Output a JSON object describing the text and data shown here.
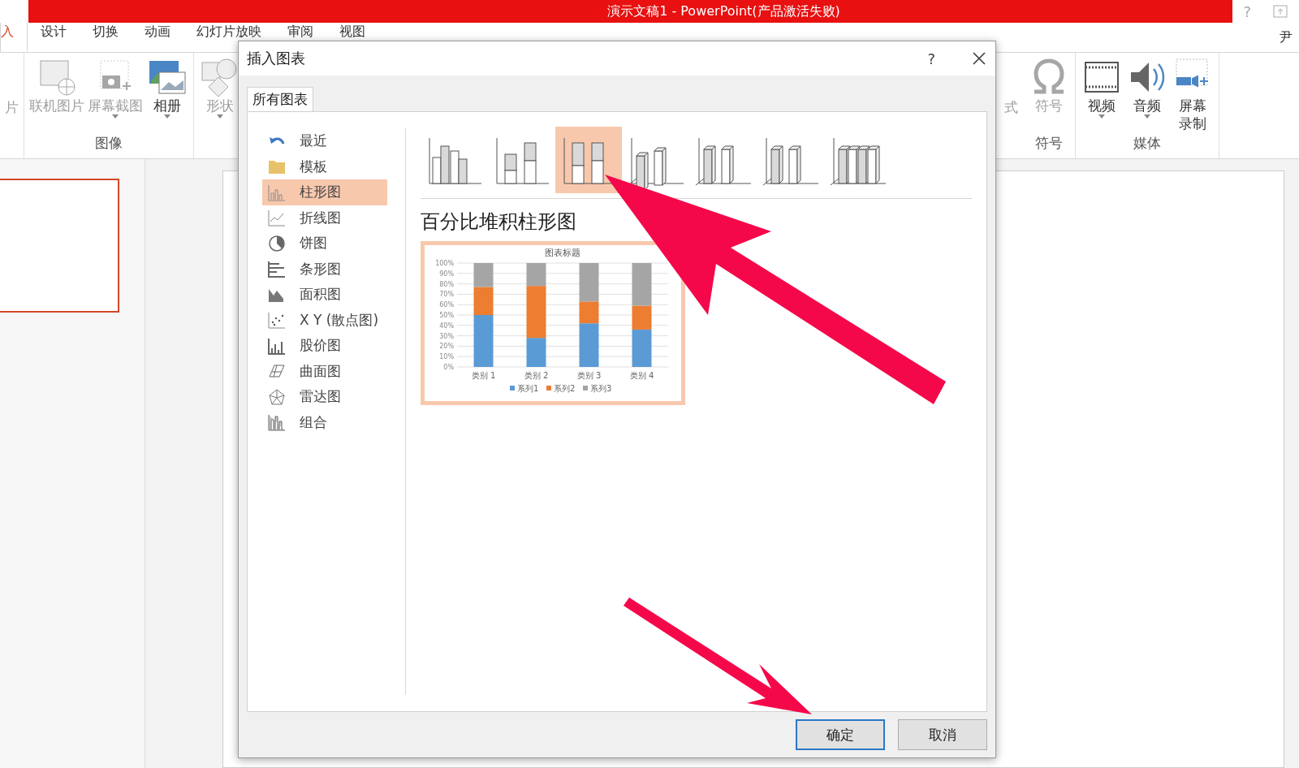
{
  "window": {
    "title": "演示文稿1 -  PowerPoint(产品激活失败)",
    "help": "?",
    "user": "尹"
  },
  "ribbon_tabs": [
    {
      "label": "入",
      "selected": true
    },
    {
      "label": "设计",
      "selected": false
    },
    {
      "label": "切换",
      "selected": false
    },
    {
      "label": "动画",
      "selected": false
    },
    {
      "label": "幻灯片放映",
      "selected": false
    },
    {
      "label": "审阅",
      "selected": false
    },
    {
      "label": "视图",
      "selected": false
    }
  ],
  "ribbon_left": {
    "cut_label": "片",
    "groups": [
      {
        "label": "图像",
        "items": [
          {
            "label": "联机图片",
            "kind": "online",
            "disabled": true,
            "dropdown": false
          },
          {
            "label": "屏幕截图",
            "kind": "screenshot",
            "disabled": true,
            "dropdown": true
          },
          {
            "label": "相册",
            "kind": "album",
            "disabled": false,
            "dropdown": true
          }
        ]
      },
      {
        "items": [
          {
            "label": "形状",
            "kind": "shapes",
            "disabled": true,
            "dropdown": true
          }
        ]
      }
    ]
  },
  "ribbon_right": {
    "cut_label": "式",
    "groups": [
      {
        "label": "符号",
        "items": [
          {
            "label": "符号",
            "kind": "omega",
            "disabled": true,
            "dropdown": false
          }
        ]
      },
      {
        "label": "媒体",
        "items": [
          {
            "label": "视频",
            "kind": "video",
            "disabled": false,
            "dropdown": true
          },
          {
            "label": "音频",
            "kind": "audio",
            "disabled": false,
            "dropdown": true
          },
          {
            "label": "屏幕录制",
            "kind": "record",
            "disabled": false,
            "dropdown": false
          }
        ]
      }
    ]
  },
  "dialog": {
    "title": "插入图表",
    "help": "?",
    "tab": "所有图表",
    "chart_types": [
      {
        "label": "最近",
        "kind": "recent",
        "selected": false
      },
      {
        "label": "模板",
        "kind": "folder",
        "selected": false
      },
      {
        "label": "柱形图",
        "kind": "column",
        "selected": true
      },
      {
        "label": "折线图",
        "kind": "line",
        "selected": false
      },
      {
        "label": "饼图",
        "kind": "pie",
        "selected": false
      },
      {
        "label": "条形图",
        "kind": "bar",
        "selected": false
      },
      {
        "label": "面积图",
        "kind": "area",
        "selected": false
      },
      {
        "label": "X Y (散点图)",
        "kind": "scatter",
        "selected": false
      },
      {
        "label": "股价图",
        "kind": "stock",
        "selected": false
      },
      {
        "label": "曲面图",
        "kind": "surface",
        "selected": false
      },
      {
        "label": "雷达图",
        "kind": "radar",
        "selected": false
      },
      {
        "label": "组合",
        "kind": "combo",
        "selected": false
      }
    ],
    "subtypes": [
      {
        "kind": "clustered",
        "selected": false
      },
      {
        "kind": "stacked",
        "selected": false
      },
      {
        "kind": "percent",
        "selected": true
      },
      {
        "kind": "clustered3d",
        "selected": false
      },
      {
        "kind": "stacked3d",
        "selected": false
      },
      {
        "kind": "percent3d",
        "selected": false
      },
      {
        "kind": "column3d",
        "selected": false
      }
    ],
    "subtype_title": "百分比堆积柱形图",
    "preview": {
      "chart_data": {
        "type": "bar",
        "title": "图表标题",
        "categories": [
          "类别 1",
          "类别 2",
          "类别 3",
          "类别 4"
        ],
        "stacked": true,
        "grid": true,
        "legend": "bottom",
        "ylim": [
          0,
          100
        ],
        "yticks": [
          {
            "value": 0,
            "label": "0%"
          },
          {
            "value": 10,
            "label": "10%"
          },
          {
            "value": 20,
            "label": "20%"
          },
          {
            "value": 30,
            "label": "30%"
          },
          {
            "value": 40,
            "label": "40%"
          },
          {
            "value": 50,
            "label": "50%"
          },
          {
            "value": 60,
            "label": "60%"
          },
          {
            "value": 70,
            "label": "70%"
          },
          {
            "value": 80,
            "label": "80%"
          },
          {
            "value": 90,
            "label": "90%"
          },
          {
            "value": 100,
            "label": "100%"
          }
        ],
        "series": [
          {
            "name": "系列1",
            "color": "#5b9bd5",
            "values": [
              50,
              28,
              42,
              36
            ]
          },
          {
            "name": "系列2",
            "color": "#ed7d31",
            "values": [
              27,
              50,
              21,
              23
            ]
          },
          {
            "name": "系列3",
            "color": "#a5a5a5",
            "values": [
              23,
              22,
              37,
              41
            ]
          }
        ]
      }
    },
    "buttons": [
      {
        "label": "确定",
        "focused": true
      },
      {
        "label": "取消",
        "focused": false
      }
    ]
  }
}
